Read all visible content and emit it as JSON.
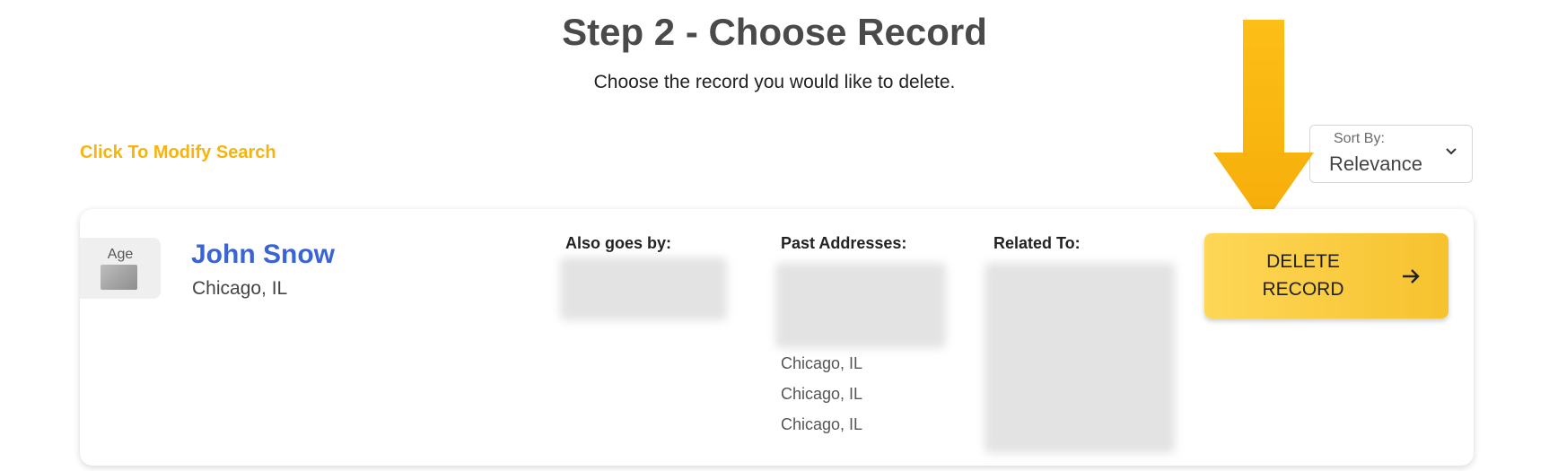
{
  "header": {
    "title": "Step 2 - Choose Record",
    "subtitle": "Choose the record you would like to delete."
  },
  "modify_search": {
    "label": "Click To Modify Search"
  },
  "sort": {
    "label": "Sort By:",
    "value": "Relevance"
  },
  "colors": {
    "accent": "#f6b40e",
    "name_link": "#3a63d6",
    "button": "#fcd24a"
  },
  "record": {
    "age_label": "Age",
    "name": "John Snow",
    "location": "Chicago, IL",
    "also_goes_by_heading": "Also goes by:",
    "past_addresses_heading": "Past Addresses:",
    "past_addresses_visible": [
      "Chicago, IL",
      "Chicago, IL",
      "Chicago, IL"
    ],
    "related_to_heading": "Related To:",
    "delete_button_label": "DELETE\nRECORD",
    "delete_button_icon": "arrow-right-icon"
  },
  "annotation_icon": "down-arrow-indicator"
}
